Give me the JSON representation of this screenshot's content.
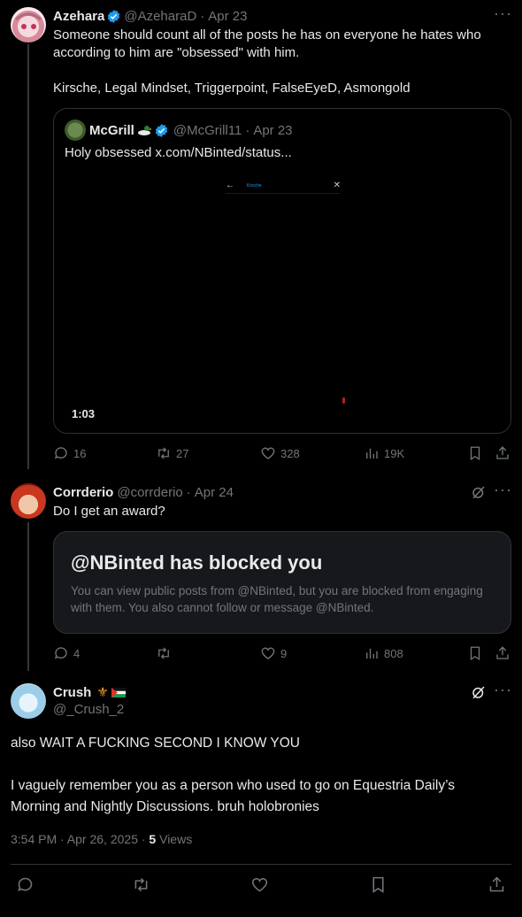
{
  "post1": {
    "display_name": "Azehara",
    "handle": "@AzeharaD",
    "date": "Apr 23",
    "text_line1": "Someone should count all of the posts he has on everyone he hates who",
    "text_line2": "according to him are \"obsessed\" with him.",
    "text_line3": "Kirsche, Legal Mindset, Triggerpoint, FalseEyeD, Asmongold",
    "quote": {
      "display_name": "McGrill",
      "handle": "@McGrill11",
      "date": "Apr 23",
      "text": "Holy obsessed  x.com/NBinted/status...",
      "video_search_text": "Kirsche",
      "video_duration": "1:03"
    },
    "stats": {
      "replies": "16",
      "reposts": "27",
      "likes": "328",
      "views": "19K"
    }
  },
  "post2": {
    "display_name": "Corrderio",
    "handle": "@corrderio",
    "date": "Apr 24",
    "text": "Do I get an award?",
    "blocked_title": "@NBinted has blocked you",
    "blocked_line1": "You can view public posts from @NBinted, but you are blocked from engaging",
    "blocked_line2": "with them. You also cannot follow or message @NBinted.",
    "stats": {
      "replies": "4",
      "reposts": "",
      "likes": "9",
      "views": "808"
    }
  },
  "post3": {
    "display_name": "Crush",
    "handle": "@_Crush_2",
    "text_line1": "also WAIT A FUCKING SECOND I KNOW YOU",
    "text_line2": "I vaguely remember you as a person who used to go on Equestria Daily’s",
    "text_line3": "Morning and Nightly Discussions. bruh holobronies",
    "time": "3:54 PM · Apr 26, 2025 · ",
    "views_count": "5",
    "views_label": " Views"
  },
  "separator": "·",
  "more": "···",
  "colors": {
    "accent": "#1d9bf0",
    "muted": "#71767b",
    "border": "#2f3336"
  }
}
